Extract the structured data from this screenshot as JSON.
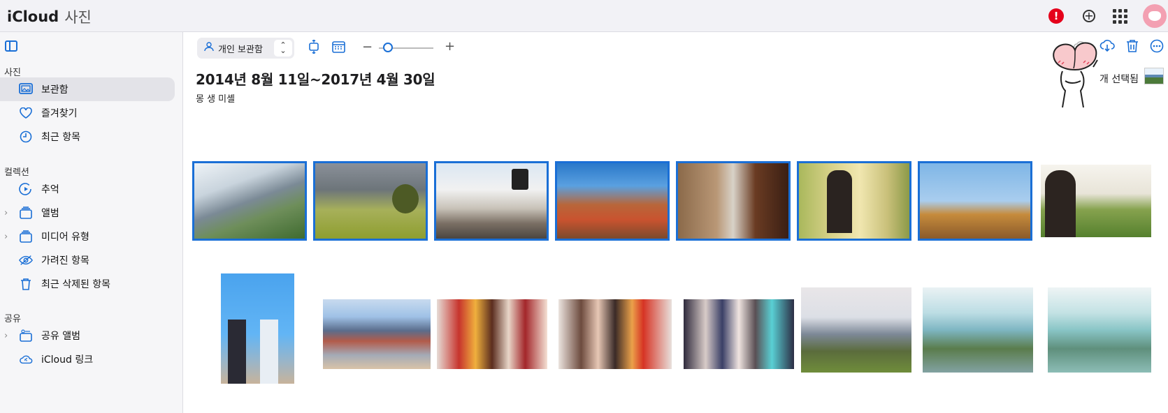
{
  "header": {
    "brand": "iCloud",
    "app": "사진",
    "alert_label": "!",
    "icons": [
      "apple-logo-icon",
      "alert-icon",
      "add-circle-icon",
      "app-grid-icon",
      "avatar"
    ]
  },
  "sidebar": {
    "sections": [
      {
        "title": "사진",
        "items": [
          {
            "label": "보관함",
            "icon": "library-icon",
            "active": true
          },
          {
            "label": "즐겨찾기",
            "icon": "heart-icon"
          },
          {
            "label": "최근 항목",
            "icon": "clock-icon"
          }
        ]
      },
      {
        "title": "컬렉션",
        "items": [
          {
            "label": "추억",
            "icon": "memories-icon"
          },
          {
            "label": "앨범",
            "icon": "albums-icon",
            "expandable": true
          },
          {
            "label": "미디어 유형",
            "icon": "media-types-icon",
            "expandable": true
          },
          {
            "label": "가려진 항목",
            "icon": "hidden-eye-icon"
          },
          {
            "label": "최근 삭제된 항목",
            "icon": "trash-icon"
          }
        ]
      },
      {
        "title": "공유",
        "items": [
          {
            "label": "공유 앨범",
            "icon": "shared-albums-icon",
            "expandable": true
          },
          {
            "label": "iCloud 링크",
            "icon": "icloud-link-icon"
          }
        ]
      }
    ]
  },
  "toolbar": {
    "library_select": "개인 보관함",
    "icons": [
      "sidebar-toggle-icon",
      "person-icon",
      "fit-icon",
      "calendar-icon",
      "zoom-out-icon",
      "zoom-in-icon",
      "upload-icon",
      "download-icon",
      "trash-icon",
      "more-icon"
    ],
    "zoom_minus": "−",
    "zoom_plus": "+",
    "zoom_level": 0.1
  },
  "content": {
    "date_range": "2014년 8월 11일~2017년 4월 30일",
    "location": "몽 생 미셸",
    "selected_text": "개 선택됨"
  },
  "colors": {
    "accent": "#1a6fd6",
    "alert": "#e5001b",
    "sidebar_bg": "#f6f6f8",
    "topbar_bg": "#f2f2f6"
  }
}
